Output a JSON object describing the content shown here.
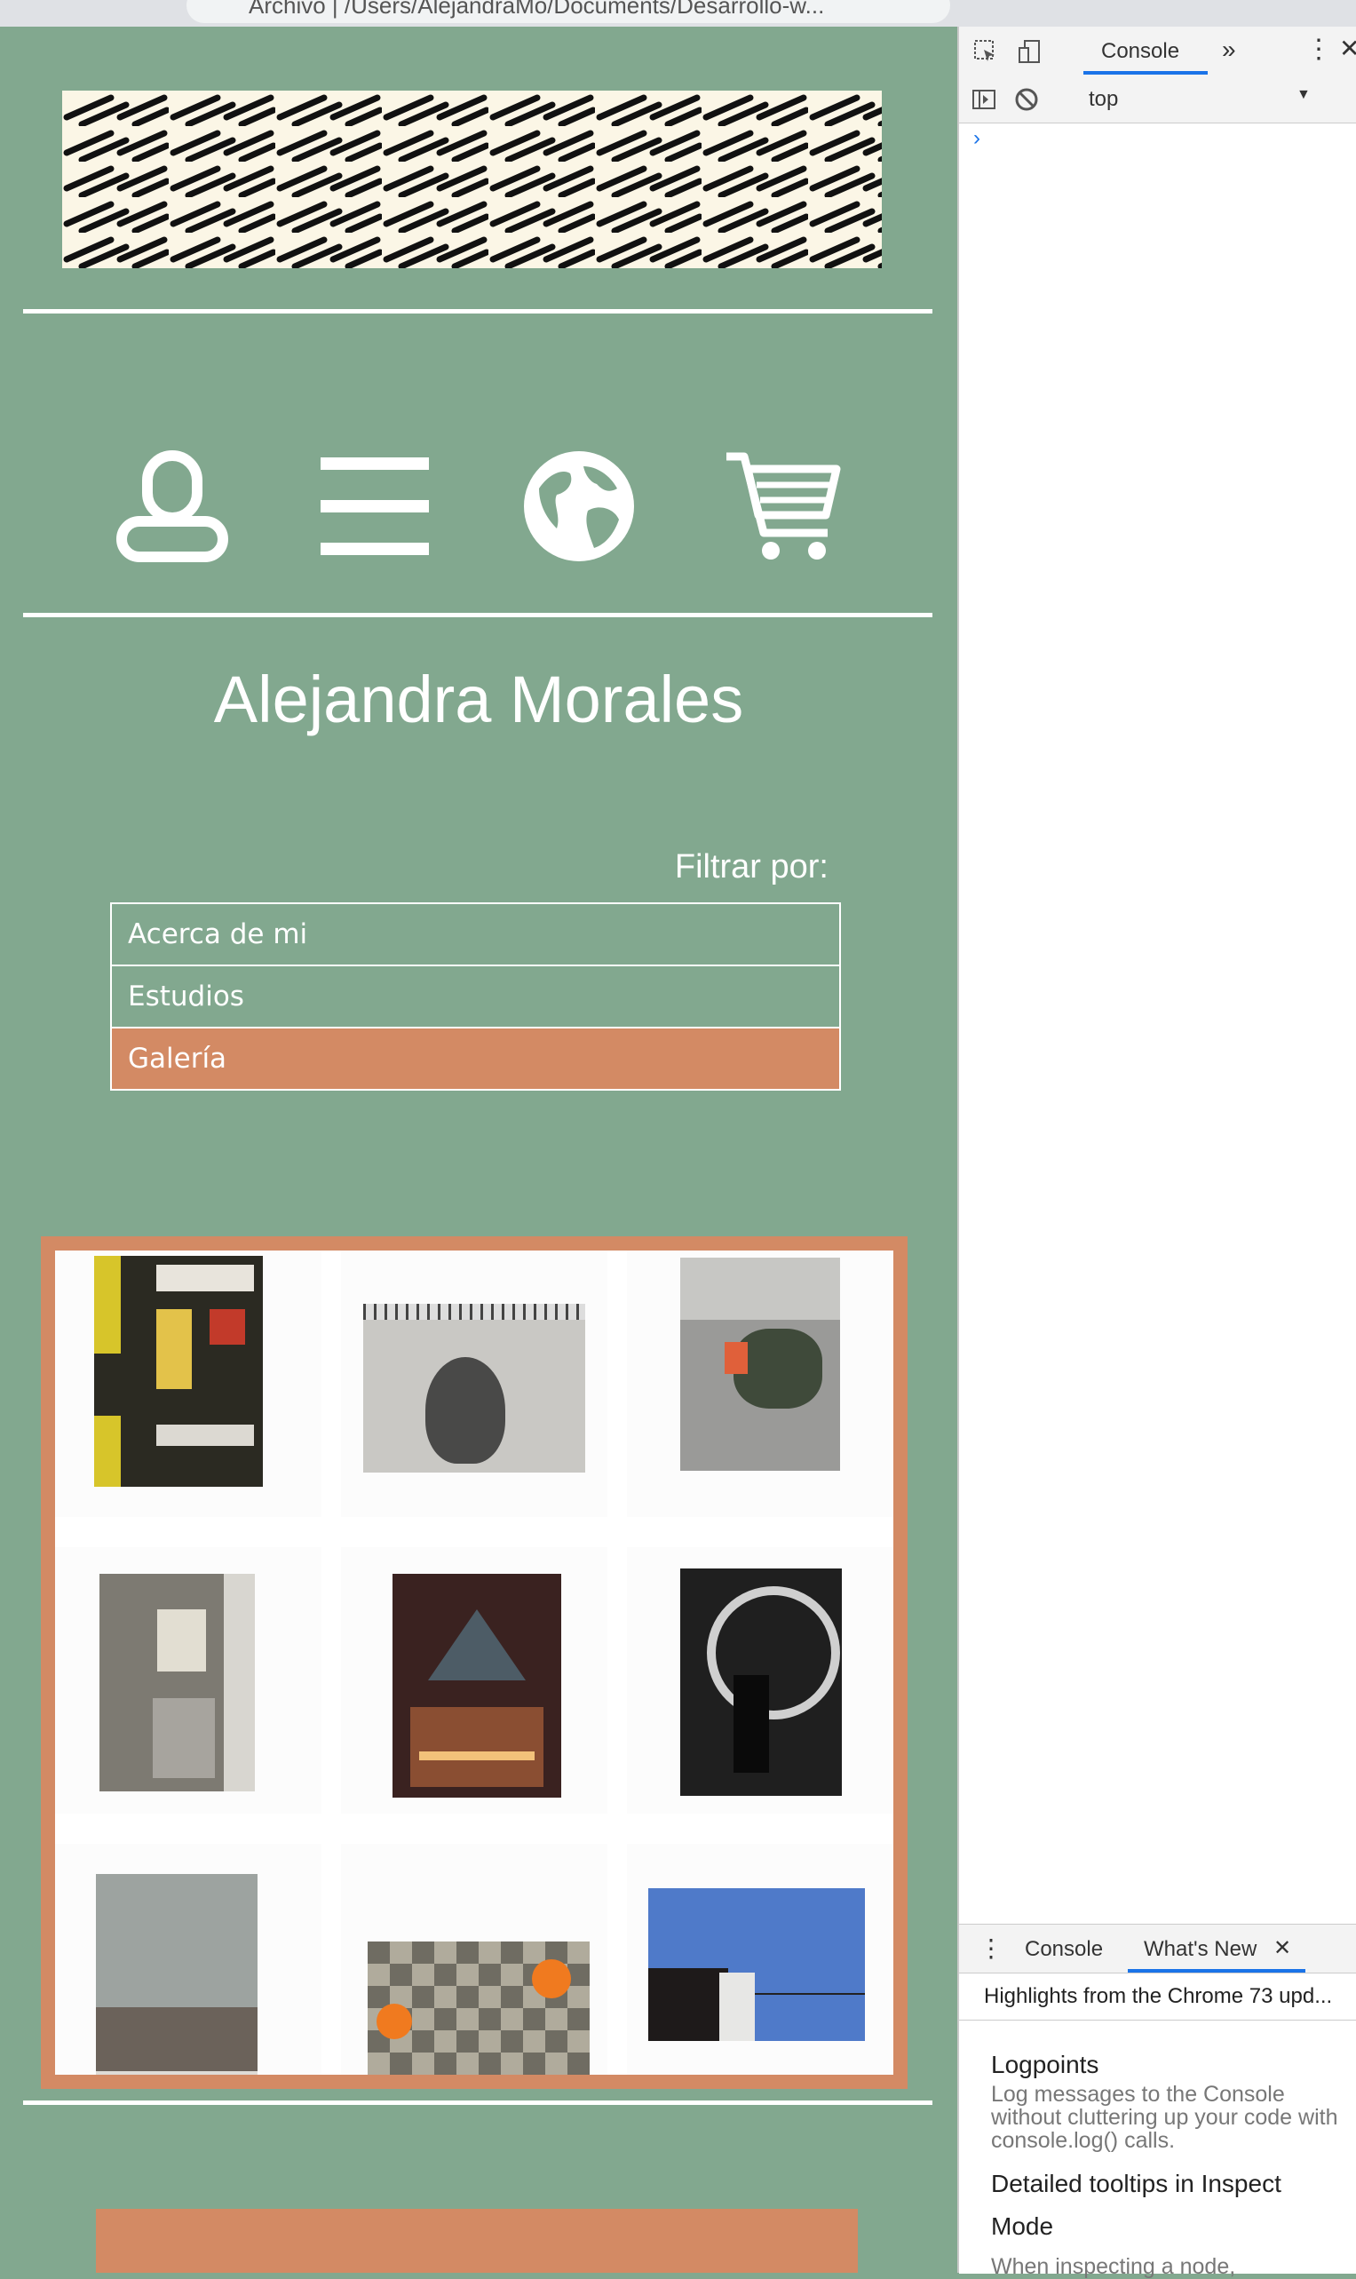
{
  "browser": {
    "address": "Archivo  |  /Users/AlejandraMo/Documents/Desarrollo-w..."
  },
  "header": {
    "nav_icons": [
      "user-icon",
      "menu-icon",
      "globe-icon",
      "cart-icon"
    ]
  },
  "main": {
    "title": "Alejandra Morales",
    "filter_label": "Filtrar por:",
    "menu": [
      {
        "label": "Acerca de mi",
        "active": false
      },
      {
        "label": "Estudios",
        "active": false
      },
      {
        "label": "Galería",
        "active": true
      }
    ]
  },
  "colors": {
    "background": "#82a88f",
    "accent": "#d38a64",
    "white": "#ffffff"
  },
  "devtools": {
    "tab_console": "Console",
    "context": "top",
    "drawer_tabs": [
      "Console",
      "What's New"
    ],
    "highlights": "Highlights from the Chrome 73 upd...",
    "whats_new": [
      {
        "title": "Logpoints",
        "desc": "Log messages to the Console without cluttering up your code with console.log() calls."
      },
      {
        "title": "Detailed tooltips in Inspect Mode",
        "desc": "When inspecting a node,"
      }
    ]
  }
}
